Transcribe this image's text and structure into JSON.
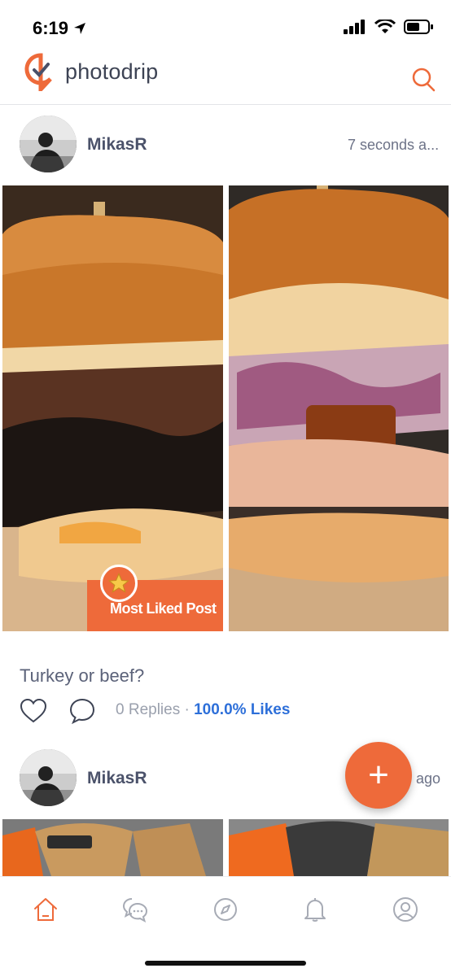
{
  "status_bar": {
    "time": "6:19"
  },
  "app": {
    "name": "photodrip"
  },
  "colors": {
    "accent": "#ee6a3a",
    "likes": "#2d6fd9",
    "text": "#3b4256"
  },
  "posts": [
    {
      "username": "MikasR",
      "time_ago": "7 seconds a...",
      "badge": "Most Liked Post",
      "caption": "Turkey or beef?",
      "replies": "0 Replies",
      "separator": "·",
      "likes": "100.0% Likes"
    },
    {
      "username": "MikasR",
      "time_ago": "ago"
    }
  ],
  "fab": {
    "label": "+"
  },
  "nav": [
    {
      "name": "home",
      "icon": "home-icon"
    },
    {
      "name": "chat",
      "icon": "chat-icon"
    },
    {
      "name": "explore",
      "icon": "compass-icon"
    },
    {
      "name": "notifications",
      "icon": "bell-icon"
    },
    {
      "name": "profile",
      "icon": "profile-icon"
    }
  ]
}
